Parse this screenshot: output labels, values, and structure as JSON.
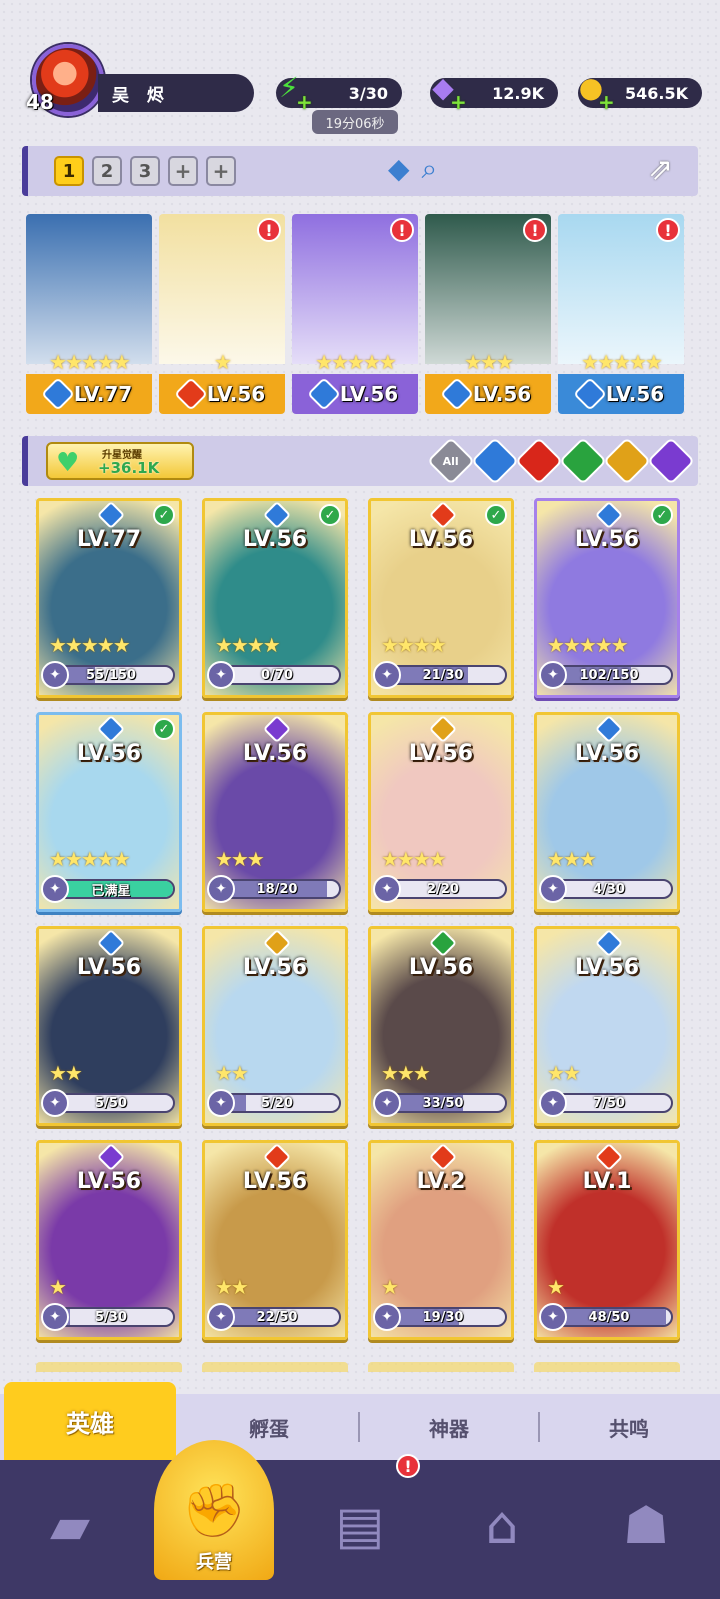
{
  "player": {
    "level": "48",
    "name": "吴 烬"
  },
  "resources": {
    "energy": "3/30",
    "energy_timer": "19分06秒",
    "gems": "12.9K",
    "gold": "546.5K"
  },
  "team_tabs": [
    "1",
    "2",
    "3",
    "+",
    "+"
  ],
  "team_heroes": [
    {
      "level": "LV.77",
      "stars": "★★★★★",
      "element": "water",
      "alert": false,
      "bg": "#3a6fb0",
      "band": "#f2a81a"
    },
    {
      "level": "LV.56",
      "stars": "★",
      "element": "fire",
      "alert": true,
      "bg": "#f2e0a0",
      "band": "#f2a81a"
    },
    {
      "level": "LV.56",
      "stars": "★★★★★",
      "element": "water",
      "alert": true,
      "bg": "#8f6fe0",
      "band": "#8a62d8"
    },
    {
      "level": "LV.56",
      "stars": "★★★",
      "element": "water",
      "alert": true,
      "bg": "#2f5a4c",
      "band": "#f2a81a"
    },
    {
      "level": "LV.56",
      "stars": "★★★★★",
      "element": "water",
      "alert": true,
      "bg": "#a8d8f0",
      "band": "#3a8ad8"
    }
  ],
  "awaken": {
    "label": "升星觉醒",
    "value": "+36.1K"
  },
  "filters": [
    "All",
    "water",
    "fire",
    "nature",
    "light",
    "dark"
  ],
  "heroes": [
    {
      "level": "LV.77",
      "element": "water",
      "frame": "gold",
      "check": true,
      "stars": "★★★★★",
      "frag": "55/150",
      "progress": 0.37,
      "bg": "#3b6e8a"
    },
    {
      "level": "LV.56",
      "element": "water",
      "frame": "gold",
      "check": true,
      "stars": "★★★★",
      "frag": "0/70",
      "progress": 0,
      "bg": "#2f8c8a"
    },
    {
      "level": "LV.56",
      "element": "fire",
      "frame": "gold",
      "check": true,
      "stars": "★★★★",
      "frag": "21/30",
      "progress": 0.7,
      "bg": "#e8d08a"
    },
    {
      "level": "LV.56",
      "element": "water",
      "frame": "purple",
      "check": true,
      "stars": "★★★★★",
      "frag": "102/150",
      "progress": 0.68,
      "bg": "#8f7ae0"
    },
    {
      "level": "LV.56",
      "element": "water",
      "frame": "blue",
      "check": true,
      "stars": "★★★★★",
      "frag": "已满星",
      "progress": 1,
      "bg": "#a8d8ee"
    },
    {
      "level": "LV.56",
      "element": "dark",
      "frame": "gold",
      "check": false,
      "stars": "★★★",
      "frag": "18/20",
      "progress": 0.9,
      "bg": "#6a4aa8"
    },
    {
      "level": "LV.56",
      "element": "light",
      "frame": "gold",
      "check": false,
      "stars": "★★★★",
      "frag": "2/20",
      "progress": 0.1,
      "bg": "#f0c8c0"
    },
    {
      "level": "LV.56",
      "element": "water",
      "frame": "gold",
      "check": false,
      "stars": "★★★",
      "frag": "4/30",
      "progress": 0.13,
      "bg": "#9fc8e8"
    },
    {
      "level": "LV.56",
      "element": "water",
      "frame": "gold",
      "check": false,
      "stars": "★★",
      "frag": "5/50",
      "progress": 0.1,
      "bg": "#2f3e5e"
    },
    {
      "level": "LV.56",
      "element": "light",
      "frame": "gold",
      "check": false,
      "stars": "★★",
      "frag": "5/20",
      "progress": 0.25,
      "bg": "#b8d8ef"
    },
    {
      "level": "LV.56",
      "element": "nature",
      "frame": "gold",
      "check": false,
      "stars": "★★★",
      "frag": "33/50",
      "progress": 0.66,
      "bg": "#5a4a4a"
    },
    {
      "level": "LV.56",
      "element": "water",
      "frame": "gold",
      "check": false,
      "stars": "★★",
      "frag": "7/50",
      "progress": 0.14,
      "bg": "#c0d8f0"
    },
    {
      "level": "LV.56",
      "element": "dark",
      "frame": "gold",
      "check": false,
      "stars": "★",
      "frag": "5/30",
      "progress": 0.17,
      "bg": "#7a3aa8"
    },
    {
      "level": "LV.56",
      "element": "fire",
      "frame": "gold",
      "check": false,
      "stars": "★★",
      "frag": "22/50",
      "progress": 0.44,
      "bg": "#c89a4a"
    },
    {
      "level": "LV.2",
      "element": "fire",
      "frame": "gold",
      "check": false,
      "stars": "★",
      "frag": "19/30",
      "progress": 0.63,
      "bg": "#e0a080"
    },
    {
      "level": "LV.1",
      "element": "fire",
      "frame": "gold",
      "check": false,
      "stars": "★",
      "frag": "48/50",
      "progress": 0.96,
      "bg": "#c0302a"
    }
  ],
  "subtabs": [
    "英雄",
    "孵蛋",
    "神器",
    "共鸣"
  ],
  "bottom_nav": {
    "active_label": "兵营"
  },
  "colors": {
    "water": "#2f7ad9",
    "fire": "#e23b1a",
    "nature": "#29a33e",
    "light": "#e0a118",
    "dark": "#7a3bd0"
  }
}
